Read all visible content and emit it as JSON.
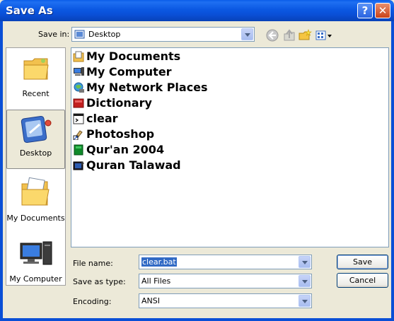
{
  "window": {
    "title": "Save As"
  },
  "titlebar": {
    "help_glyph": "?",
    "close_glyph": "✕"
  },
  "save_in": {
    "label": "Save in:",
    "value": "Desktop",
    "icon": "desktop-icon"
  },
  "toolbar": {
    "icons": [
      "back-icon",
      "up-folder-icon",
      "new-folder-icon",
      "views-menu-icon"
    ]
  },
  "places_bar": {
    "items": [
      {
        "label": "Recent",
        "icon": "recent-folder-icon",
        "selected": false
      },
      {
        "label": "Desktop",
        "icon": "desktop-icon",
        "selected": true
      },
      {
        "label": "My Documents",
        "icon": "my-documents-icon",
        "selected": false
      },
      {
        "label": "My Computer",
        "icon": "my-computer-icon",
        "selected": false
      }
    ]
  },
  "files": [
    {
      "name": "My Documents",
      "icon": "my-documents-icon"
    },
    {
      "name": "My Computer",
      "icon": "my-computer-icon"
    },
    {
      "name": "My Network Places",
      "icon": "network-places-icon"
    },
    {
      "name": "Dictionary",
      "icon": "dictionary-icon"
    },
    {
      "name": "clear",
      "icon": "batch-file-icon"
    },
    {
      "name": "Photoshop",
      "icon": "shortcut-icon"
    },
    {
      "name": "Qur'an 2004",
      "icon": "green-book-icon"
    },
    {
      "name": "Quran Talawad",
      "icon": "media-icon"
    }
  ],
  "file_name": {
    "label": "File name:",
    "value": "clear.bat"
  },
  "save_as_type": {
    "label": "Save as type:",
    "value": "All Files"
  },
  "encoding": {
    "label": "Encoding:",
    "value": "ANSI"
  },
  "buttons": {
    "save": "Save",
    "cancel": "Cancel"
  },
  "colors": {
    "title_bar": "#0a4fd6",
    "dialog_bg": "#ece9d8",
    "selection": "#316ac5"
  }
}
